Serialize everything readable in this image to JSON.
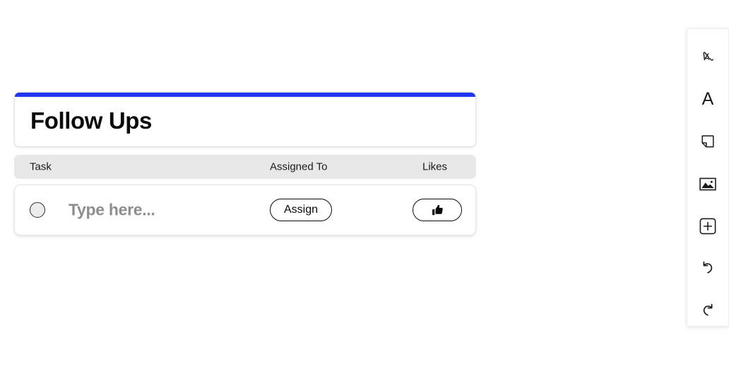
{
  "widget": {
    "accent_color": "#1f35f0",
    "title": "Follow Ups",
    "columns": {
      "task": "Task",
      "assigned_to": "Assigned To",
      "likes": "Likes"
    },
    "row": {
      "checkbox_state": "unchecked",
      "task_value": "",
      "task_placeholder": "Type here...",
      "assign_label": "Assign",
      "like_icon": "thumbs-up-icon"
    }
  },
  "toolbar": {
    "items": [
      {
        "name": "draw-icon",
        "label": "Draw"
      },
      {
        "name": "text-icon",
        "label": "A"
      },
      {
        "name": "note-icon",
        "label": "Note"
      },
      {
        "name": "image-icon",
        "label": "Image"
      },
      {
        "name": "add-icon",
        "label": "Add"
      },
      {
        "name": "undo-icon",
        "label": "Undo"
      },
      {
        "name": "redo-icon",
        "label": "Redo"
      }
    ]
  }
}
